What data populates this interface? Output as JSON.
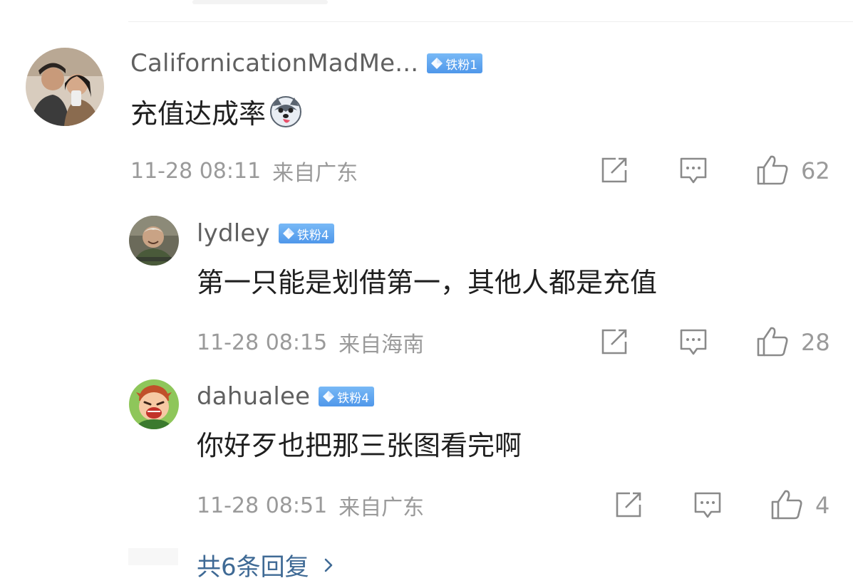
{
  "comments": [
    {
      "username": "CalifornicationMadMe...",
      "badge": "铁粉1",
      "text": "充值达成率",
      "emoji_icon": "husky-emoji-icon",
      "time": "11-28 08:11",
      "location": "来自广东",
      "likes": "62"
    },
    {
      "username": "lydley",
      "badge": "铁粉4",
      "text": "第一只能是划借第一，其他人都是充值",
      "time": "11-28 08:15",
      "location": "来自海南",
      "likes": "28"
    },
    {
      "username": "dahualee",
      "badge": "铁粉4",
      "text": "你好歹也把那三张图看完啊",
      "time": "11-28 08:51",
      "location": "来自广东",
      "likes": "4"
    }
  ],
  "replies_link": "共6条回复",
  "icons": {
    "share": "share-icon",
    "comment": "comment-icon",
    "like": "thumbs-up-icon",
    "badge": "diamond-icon",
    "chevron": "chevron-right-icon"
  },
  "colors": {
    "badge": "#5a9fee",
    "link": "#3f6a95",
    "meta": "#9a9a9a"
  }
}
